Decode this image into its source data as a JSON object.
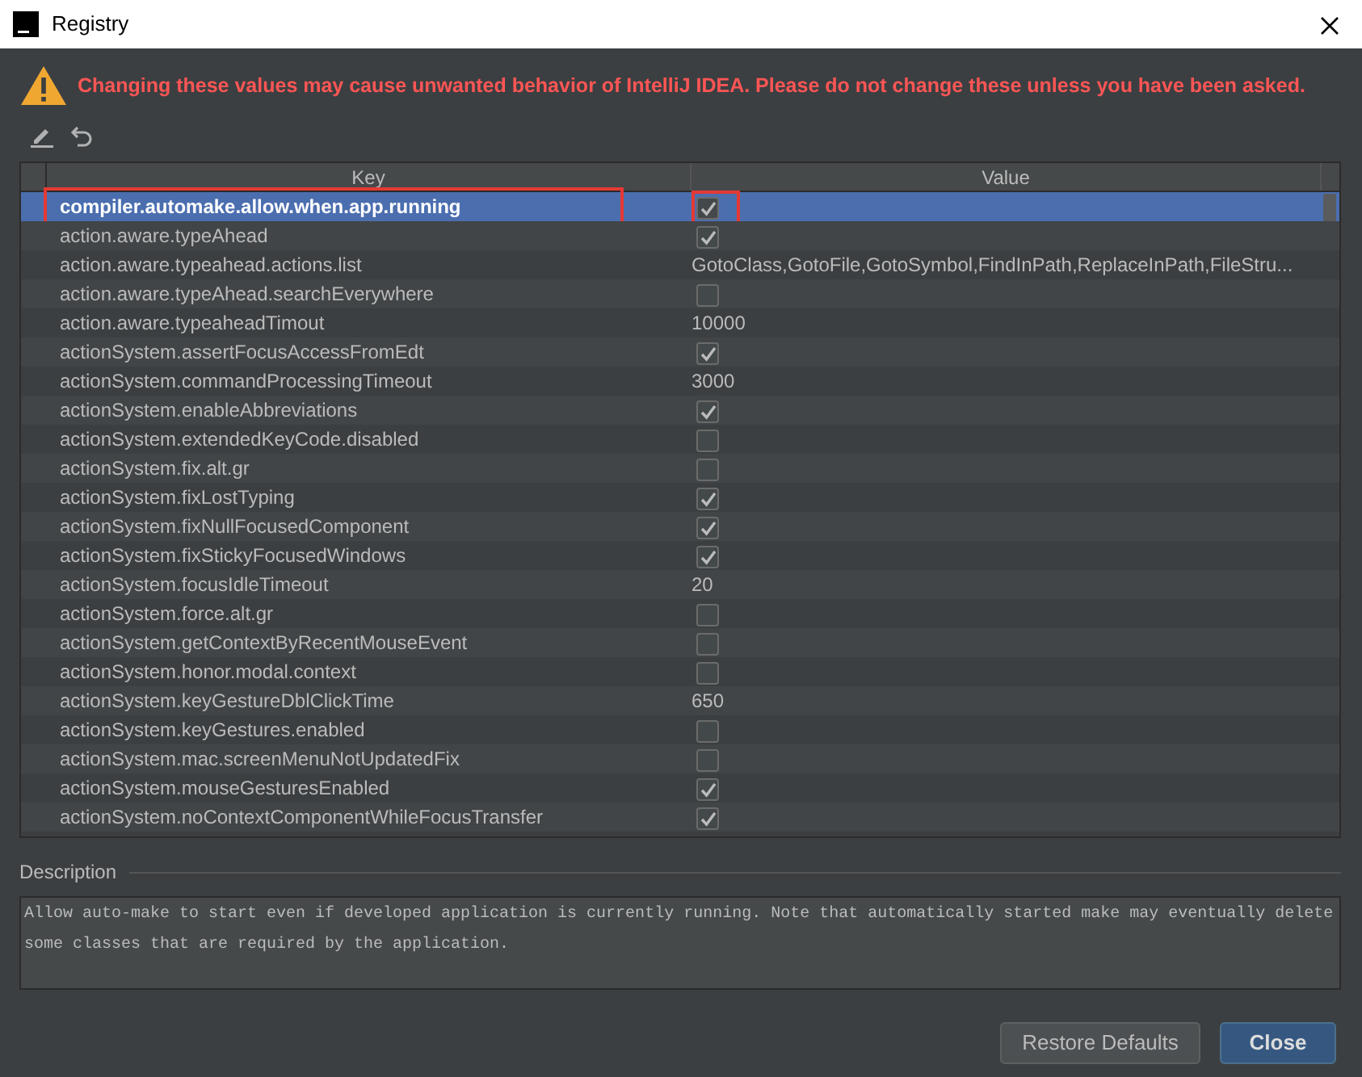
{
  "window": {
    "title": "Registry"
  },
  "warning": "Changing these values may cause unwanted behavior of IntelliJ IDEA. Please do not change these unless you have been asked.",
  "table": {
    "columns": [
      "Key",
      "Value"
    ],
    "rows": [
      {
        "key": "compiler.automake.allow.when.app.running",
        "kind": "bool",
        "checked": true,
        "selected": true,
        "annotated": true
      },
      {
        "key": "action.aware.typeAhead",
        "kind": "bool",
        "checked": true,
        "selected": false,
        "annotated": false
      },
      {
        "key": "action.aware.typeahead.actions.list",
        "kind": "text",
        "value": "GotoClass,GotoFile,GotoSymbol,FindInPath,ReplaceInPath,FileStru...",
        "selected": false,
        "annotated": false
      },
      {
        "key": "action.aware.typeAhead.searchEverywhere",
        "kind": "bool",
        "checked": false,
        "selected": false,
        "annotated": false
      },
      {
        "key": "action.aware.typeaheadTimout",
        "kind": "text",
        "value": "10000",
        "selected": false,
        "annotated": false
      },
      {
        "key": "actionSystem.assertFocusAccessFromEdt",
        "kind": "bool",
        "checked": true,
        "selected": false,
        "annotated": false
      },
      {
        "key": "actionSystem.commandProcessingTimeout",
        "kind": "text",
        "value": "3000",
        "selected": false,
        "annotated": false
      },
      {
        "key": "actionSystem.enableAbbreviations",
        "kind": "bool",
        "checked": true,
        "selected": false,
        "annotated": false
      },
      {
        "key": "actionSystem.extendedKeyCode.disabled",
        "kind": "bool",
        "checked": false,
        "selected": false,
        "annotated": false
      },
      {
        "key": "actionSystem.fix.alt.gr",
        "kind": "bool",
        "checked": false,
        "selected": false,
        "annotated": false
      },
      {
        "key": "actionSystem.fixLostTyping",
        "kind": "bool",
        "checked": true,
        "selected": false,
        "annotated": false
      },
      {
        "key": "actionSystem.fixNullFocusedComponent",
        "kind": "bool",
        "checked": true,
        "selected": false,
        "annotated": false
      },
      {
        "key": "actionSystem.fixStickyFocusedWindows",
        "kind": "bool",
        "checked": true,
        "selected": false,
        "annotated": false
      },
      {
        "key": "actionSystem.focusIdleTimeout",
        "kind": "text",
        "value": "20",
        "selected": false,
        "annotated": false
      },
      {
        "key": "actionSystem.force.alt.gr",
        "kind": "bool",
        "checked": false,
        "selected": false,
        "annotated": false
      },
      {
        "key": "actionSystem.getContextByRecentMouseEvent",
        "kind": "bool",
        "checked": false,
        "selected": false,
        "annotated": false
      },
      {
        "key": "actionSystem.honor.modal.context",
        "kind": "bool",
        "checked": false,
        "selected": false,
        "annotated": false
      },
      {
        "key": "actionSystem.keyGestureDblClickTime",
        "kind": "text",
        "value": "650",
        "selected": false,
        "annotated": false
      },
      {
        "key": "actionSystem.keyGestures.enabled",
        "kind": "bool",
        "checked": false,
        "selected": false,
        "annotated": false
      },
      {
        "key": "actionSystem.mac.screenMenuNotUpdatedFix",
        "kind": "bool",
        "checked": false,
        "selected": false,
        "annotated": false
      },
      {
        "key": "actionSystem.mouseGesturesEnabled",
        "kind": "bool",
        "checked": true,
        "selected": false,
        "annotated": false
      },
      {
        "key": "actionSystem.noContextComponentWhileFocusTransfer",
        "kind": "bool",
        "checked": true,
        "selected": false,
        "annotated": false
      }
    ]
  },
  "description": {
    "label": "Description",
    "text": "Allow auto-make to start even if developed application is currently running. Note that automatically started make may eventually delete some classes that are required by the application."
  },
  "buttons": [
    {
      "label": "Restore Defaults",
      "kind": "secondary"
    },
    {
      "label": "Close",
      "kind": "primary"
    }
  ]
}
